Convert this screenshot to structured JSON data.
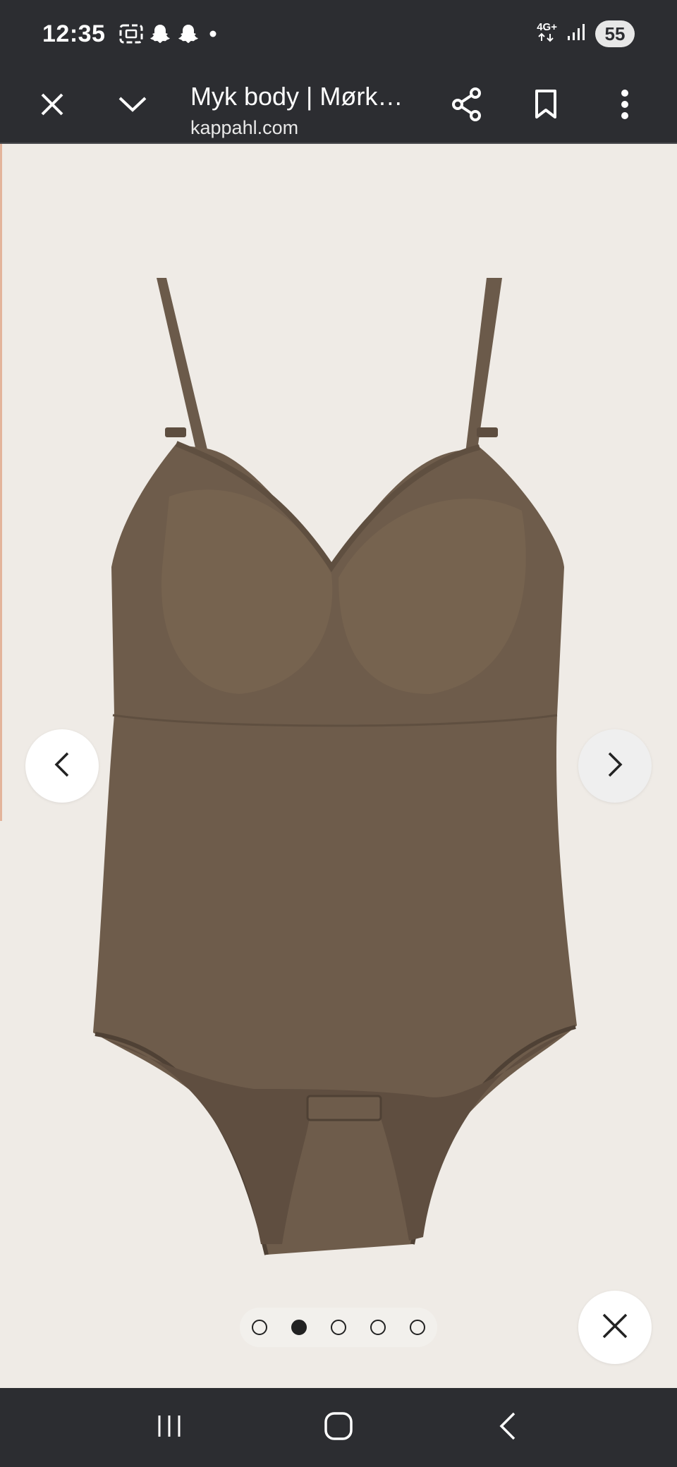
{
  "status_bar": {
    "time": "12:35",
    "network_top": "4G+",
    "battery": "55",
    "icons": [
      "screenshot-icon",
      "snapchat-icon",
      "snapchat-icon",
      "dot-icon",
      "data-arrows-icon",
      "signal-icon"
    ]
  },
  "toolbar": {
    "page_title": "Myk body | Mørk…",
    "url": "kappahl.com",
    "icons": [
      "close-icon",
      "chevron-down-icon",
      "share-icon",
      "bookmark-icon",
      "more-vert-icon"
    ]
  },
  "gallery": {
    "image_subject": "dark brown body with soft cups and adjustable straps",
    "product_color": "#6e5c4b",
    "background_color": "#efebe6",
    "total_images": 5,
    "active_image_index": 1,
    "prev_icon": "chevron-left-icon",
    "next_icon": "chevron-right-icon",
    "close_icon": "close-icon"
  },
  "system_nav": {
    "icons": [
      "recent-apps-icon",
      "home-icon",
      "back-icon"
    ]
  }
}
